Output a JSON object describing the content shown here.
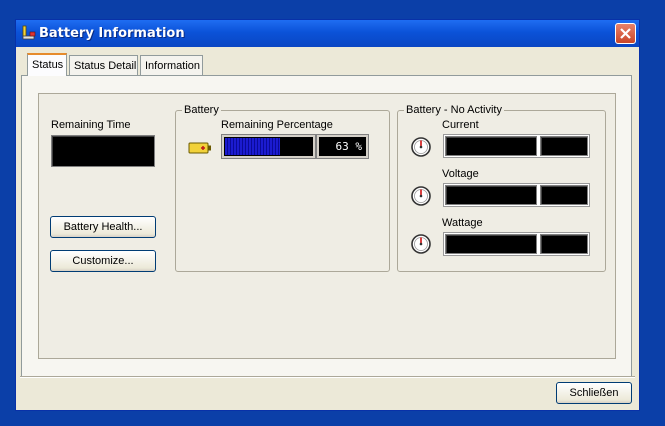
{
  "window": {
    "title": "Battery Information"
  },
  "tabs": [
    {
      "label": "Status",
      "active": true
    },
    {
      "label": "Status Detail",
      "active": false
    },
    {
      "label": "Information",
      "active": false
    }
  ],
  "status": {
    "remaining_time_label": "Remaining Time",
    "remaining_time_value": "",
    "battery_health_button": "Battery Health...",
    "customize_button": "Customize..."
  },
  "battery_group": {
    "title": "Battery",
    "remaining_percentage_label": "Remaining Percentage",
    "percentage": 63,
    "percentage_text": "63 %"
  },
  "activity_group": {
    "title": "Battery - No Activity",
    "current_label": "Current",
    "voltage_label": "Voltage",
    "wattage_label": "Wattage"
  },
  "footer": {
    "close_button": "Schließen"
  },
  "icons": [
    "battery-app-icon",
    "close-icon",
    "battery-icon",
    "gauge-icon"
  ],
  "colors": {
    "titlebar": "#0b52d8",
    "face": "#ece9d8",
    "bar_fill": "#1b1bd0",
    "tab_highlight": "#e68b2c"
  }
}
